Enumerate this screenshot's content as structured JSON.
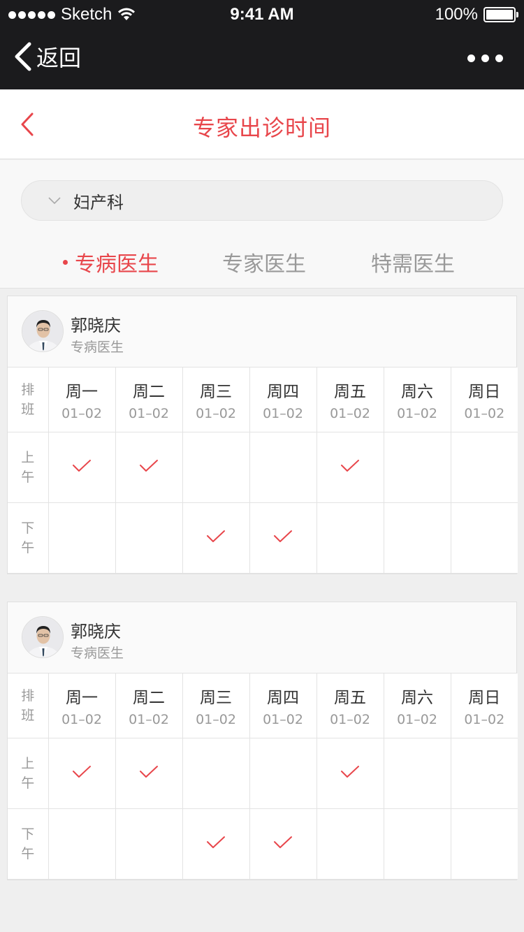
{
  "statusbar": {
    "carrier": "Sketch",
    "time": "9:41 AM",
    "battery": "100%"
  },
  "navbar": {
    "back_label": "返回",
    "back_icon": "chevron-left-icon",
    "more_icon": "more-dots-icon"
  },
  "header": {
    "title": "专家出诊时间"
  },
  "department": {
    "selected": "妇产科"
  },
  "tabs": [
    {
      "label": "专病医生",
      "active": true
    },
    {
      "label": "专家医生",
      "active": false
    },
    {
      "label": "特需医生",
      "active": false
    }
  ],
  "colors": {
    "accent": "#e8464b",
    "topbar": "#1b1b1d"
  },
  "schedule_header": {
    "row_label": [
      "排",
      "班"
    ],
    "days": [
      {
        "name": "周一",
        "date": "01–02"
      },
      {
        "name": "周二",
        "date": "01–02"
      },
      {
        "name": "周三",
        "date": "01–02"
      },
      {
        "name": "周四",
        "date": "01–02"
      },
      {
        "name": "周五",
        "date": "01–02"
      },
      {
        "name": "周六",
        "date": "01–02"
      },
      {
        "name": "周日",
        "date": "01–02"
      }
    ],
    "morning": [
      "上",
      "午"
    ],
    "afternoon": [
      "下",
      "午"
    ]
  },
  "doctors": [
    {
      "name": "郭晓庆",
      "role": "专病医生",
      "morning": [
        true,
        true,
        false,
        false,
        true,
        false,
        false
      ],
      "afternoon": [
        false,
        false,
        true,
        true,
        false,
        false,
        false
      ]
    },
    {
      "name": "郭晓庆",
      "role": "专病医生",
      "morning": [
        true,
        true,
        false,
        false,
        true,
        false,
        false
      ],
      "afternoon": [
        false,
        false,
        true,
        true,
        false,
        false,
        false
      ]
    }
  ]
}
